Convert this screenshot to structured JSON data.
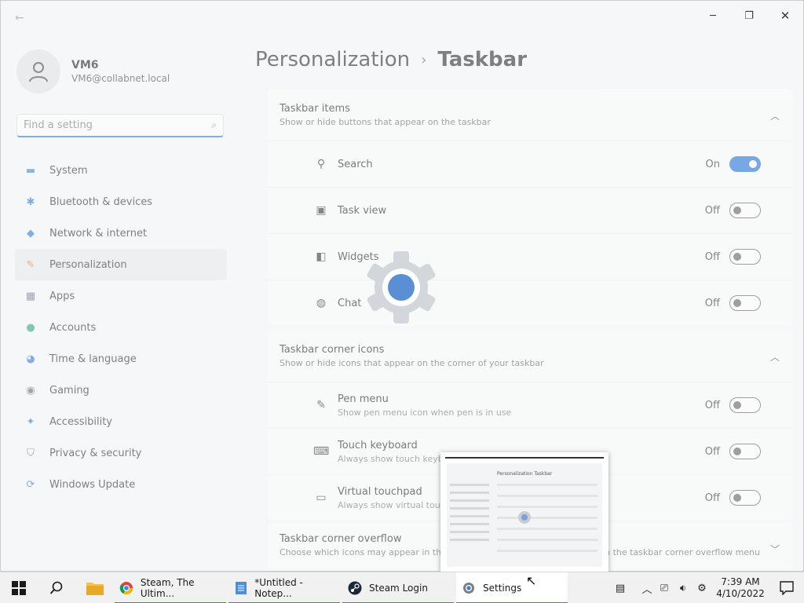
{
  "window": {
    "back_label": "←",
    "minimize_label": "─",
    "maximize_label": "❐",
    "close_label": "✕"
  },
  "user": {
    "name": "VM6",
    "email": "VM6@collabnet.local"
  },
  "search": {
    "placeholder": "Find a setting"
  },
  "nav": {
    "items": [
      {
        "label": "System",
        "icon": "system-icon",
        "glyph": "▬",
        "color": "#3b88c8"
      },
      {
        "label": "Bluetooth & devices",
        "icon": "bluetooth-icon",
        "glyph": "✱",
        "color": "#2b7ad9"
      },
      {
        "label": "Network & internet",
        "icon": "wifi-icon",
        "glyph": "◆",
        "color": "#2b7ad9"
      },
      {
        "label": "Personalization",
        "icon": "brush-icon",
        "glyph": "✎",
        "color": "#d9822b"
      },
      {
        "label": "Apps",
        "icon": "apps-icon",
        "glyph": "▦",
        "color": "#5a6b80"
      },
      {
        "label": "Accounts",
        "icon": "accounts-icon",
        "glyph": "●",
        "color": "#2aa876"
      },
      {
        "label": "Time & language",
        "icon": "globe-clock-icon",
        "glyph": "◕",
        "color": "#2b7ad9"
      },
      {
        "label": "Gaming",
        "icon": "gamepad-icon",
        "glyph": "◉",
        "color": "#6b6b6b"
      },
      {
        "label": "Accessibility",
        "icon": "accessibility-icon",
        "glyph": "✦",
        "color": "#2b7ad9"
      },
      {
        "label": "Privacy & security",
        "icon": "shield-icon",
        "glyph": "⛉",
        "color": "#6b6b6b"
      },
      {
        "label": "Windows Update",
        "icon": "update-icon",
        "glyph": "⟳",
        "color": "#2b7ad9"
      }
    ],
    "active_index": 3
  },
  "breadcrumb": {
    "parent": "Personalization",
    "separator": "›",
    "current": "Taskbar"
  },
  "taskbar_items": {
    "title": "Taskbar items",
    "subtitle": "Show or hide buttons that appear on the taskbar",
    "rows": [
      {
        "label": "Search",
        "state": "On",
        "icon": "search-icon"
      },
      {
        "label": "Task view",
        "state": "Off",
        "icon": "task-view-icon"
      },
      {
        "label": "Widgets",
        "state": "Off",
        "icon": "widgets-icon"
      },
      {
        "label": "Chat",
        "state": "Off",
        "icon": "chat-icon"
      }
    ]
  },
  "corner_icons": {
    "title": "Taskbar corner icons",
    "subtitle": "Show or hide icons that appear on the corner of your taskbar",
    "rows": [
      {
        "label": "Pen menu",
        "desc": "Show pen menu icon when pen is in use",
        "state": "Off",
        "icon": "pen-icon"
      },
      {
        "label": "Touch keyboard",
        "desc": "Always show touch keyb",
        "state": "Off",
        "icon": "keyboard-icon"
      },
      {
        "label": "Virtual touchpad",
        "desc": "Always show virtual touch",
        "state": "Off",
        "icon": "touchpad-icon"
      }
    ]
  },
  "corner_overflow": {
    "title": "Taskbar corner overflow",
    "subtitle": "Choose which icons may appear in the",
    "subtitle_tail": "n the taskbar corner overflow menu"
  },
  "thumbnail": {
    "crumb": "Personalization   Taskbar"
  },
  "taskbar": {
    "apps": [
      {
        "label": "Steam, The Ultim...",
        "icon": "chrome-icon"
      },
      {
        "label": "*Untitled - Notep...",
        "icon": "notepad-icon"
      },
      {
        "label": "Steam Login",
        "icon": "steam-icon"
      },
      {
        "label": "Settings",
        "icon": "settings-icon"
      }
    ],
    "time": "7:39 AM",
    "date": "4/10/2022"
  },
  "colors": {
    "accent": "#1e6fd9",
    "taskbar_bg": "#f1f1f1"
  }
}
